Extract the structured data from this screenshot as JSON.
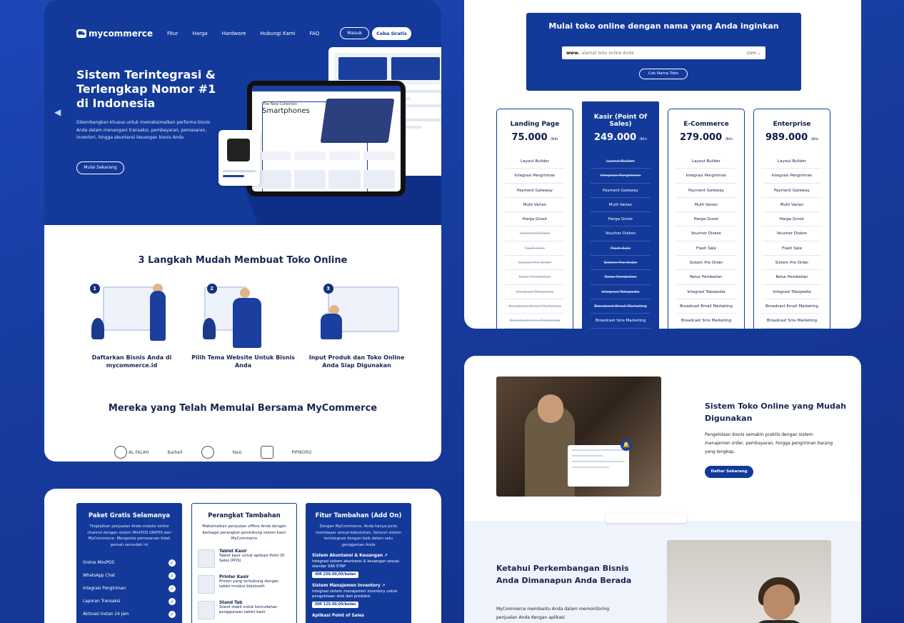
{
  "hero": {
    "logo": "mycommerce",
    "nav": [
      "Fitur",
      "Harga",
      "Hardware",
      "Hubungi Kami",
      "FAQ"
    ],
    "masuk": "Masuk",
    "coba": "Coba Gratis",
    "title": "Sistem Terintegrasi & Terlengkap Nomor #1 di Indonesia",
    "desc": "Dikembangkan khusus untuk memaksimalkan performa bisnis Anda dalam menangani transaksi, pembayaran, pemasaran, inventori, hingga akuntansi keuangan bisnis Anda",
    "cta": "Mulai Sekarang",
    "tablet_collection": "The New Collection",
    "tablet_heading": "Smartphones"
  },
  "steps": {
    "title": "3 Langkah Mudah Membuat Toko Online",
    "items": [
      {
        "num": "1",
        "label": "Daftarkan Bisnis Anda di mycommerce.id"
      },
      {
        "num": "2",
        "label": "Pilih Tema Website Untuk Bisnis Anda"
      },
      {
        "num": "3",
        "label": "Input Produk dan Toko Online Anda Siap Digunakan"
      }
    ]
  },
  "clients": {
    "title": "Mereka yang Telah Memulai Bersama MyCommerce",
    "logos": [
      "AL FALAH",
      "Barbell",
      "",
      "Nasi",
      "",
      "PIPIKORO"
    ]
  },
  "domain": {
    "title": "Mulai toko online dengan nama yang Anda inginkan",
    "prefix": "www.",
    "placeholder": "alamat toko online Anda",
    "suffix": ".com",
    "button": "Cek Nama Toko"
  },
  "plans": [
    {
      "name": "Landing Page",
      "price": "75.000",
      "per": "/bln",
      "featured": false,
      "features": [
        [
          "Layout Builder",
          true
        ],
        [
          "Integrasi Pengiriman",
          true
        ],
        [
          "Payment Gateway",
          true
        ],
        [
          "Multi Varian",
          true
        ],
        [
          "Harga Grosir",
          true
        ],
        [
          "Voucher Diskon",
          false
        ],
        [
          "Flash Sale",
          false
        ],
        [
          "Sistem Pre Order",
          false
        ],
        [
          "Retur Pembelian",
          false
        ],
        [
          "Integrasi Tokopedia",
          false
        ],
        [
          "Broadcast Email Marketing",
          false
        ],
        [
          "Broadcast Sms Marketing",
          false
        ]
      ]
    },
    {
      "name": "Kasir (Point Of Sales)",
      "price": "249.000",
      "per": "/bln",
      "featured": true,
      "features": [
        [
          "Layout Builder",
          false
        ],
        [
          "Integrasi Pengiriman",
          false
        ],
        [
          "Payment Gateway",
          true
        ],
        [
          "Multi Varian",
          true
        ],
        [
          "Harga Grosir",
          true
        ],
        [
          "Voucher Diskon",
          true
        ],
        [
          "Flash Sale",
          false
        ],
        [
          "Sistem Pre Order",
          false
        ],
        [
          "Retur Pembelian",
          false
        ],
        [
          "Integrasi Tokopedia",
          false
        ],
        [
          "Broadcast Email Marketing",
          false
        ],
        [
          "Broadcast Sms Marketing",
          true
        ]
      ]
    },
    {
      "name": "E-Commerce",
      "price": "279.000",
      "per": "/bln",
      "featured": false,
      "features": [
        [
          "Layout Builder",
          true
        ],
        [
          "Integrasi Pengiriman",
          true
        ],
        [
          "Payment Gateway",
          true
        ],
        [
          "Multi Varian",
          true
        ],
        [
          "Harga Grosir",
          true
        ],
        [
          "Voucher Diskon",
          true
        ],
        [
          "Flash Sale",
          true
        ],
        [
          "Sistem Pre Order",
          true
        ],
        [
          "Retur Pembelian",
          true
        ],
        [
          "Integrasi Tokopedia",
          true
        ],
        [
          "Broadcast Email Marketing",
          true
        ],
        [
          "Broadcast Sms Marketing",
          true
        ]
      ]
    },
    {
      "name": "Enterprise",
      "price": "989.000",
      "per": "/bln",
      "featured": false,
      "features": [
        [
          "Layout Builder",
          true
        ],
        [
          "Integrasi Pengiriman",
          true
        ],
        [
          "Payment Gateway",
          true
        ],
        [
          "Multi Varian",
          true
        ],
        [
          "Harga Grosir",
          true
        ],
        [
          "Voucher Diskon",
          true
        ],
        [
          "Flash Sale",
          true
        ],
        [
          "Sistem Pre Order",
          true
        ],
        [
          "Retur Pembelian",
          true
        ],
        [
          "Integrasi Tokopedia",
          true
        ],
        [
          "Broadcast Email Marketing",
          true
        ],
        [
          "Broadcast Sms Marketing",
          true
        ]
      ]
    }
  ],
  "paket": {
    "title": "Paket Gratis Selamanya",
    "desc": "Tingkatkan penjualan Anda melalui online channel dengan sistem MiniPOS GRATIS dari MyCommerce. Mengelola pemesanan tidak pernah semudah ini",
    "items": [
      "Online MiniPOS",
      "WhatsApp Chat",
      "Integrasi Pengiriman",
      "Laporan Transaksi",
      "Aktivasi Instan 24 Jam"
    ]
  },
  "perangkat": {
    "title": "Perangkat Tambahan",
    "desc": "Maksimalkan penjualan offline Anda dengan berbagai perangkat pendukung sistem kasir MyCommerce",
    "items": [
      {
        "name": "Tablet Kasir",
        "desc": "Tablet kasir untuk aplikasi Point Of Sales (POS)"
      },
      {
        "name": "Printer Kasir",
        "desc": "Printer yang terhubung dengan tablet melalui bluetooth"
      },
      {
        "name": "Stand Tab",
        "desc": "Stand stabil untuk kemudahan penggunaan tablet kasir"
      }
    ]
  },
  "addon": {
    "title": "Fitur Tambahan (Add On)",
    "desc": "Dengan MyCommerce, Anda hanya perlu membayar sesuai kebutuhan. Seluruh sistem terintegrasi dengan baik dalam satu genggaman Anda",
    "items": [
      {
        "name": "Sistem Akuntansi & Keuangan",
        "desc": "Integrasi sistem akuntansi & keuangan sesuai standar SAK ETAP",
        "price": "IDR 250.00,00/bulan"
      },
      {
        "name": "Sistem Manajemen Inventory",
        "desc": "Integrasi sistem manajemen inventory untuk pengelolaan stok dan produksi",
        "price": "IDR 125.00,00/bulan"
      },
      {
        "name": "Aplikasi Point of Sales",
        "desc": "",
        "price": ""
      }
    ]
  },
  "toko": {
    "title": "Sistem Toko Online yang Mudah Digunakan",
    "desc": "Pengelolaan bisnis semakin praktis dengan sistem manajemen order, pembayaran, hingga pengiriman barang yang lengkap.",
    "button": "Daftar Sekarang"
  },
  "ketahui": {
    "title": "Ketahui Perkembangan Bisnis Anda Dimanapun Anda Berada",
    "desc": "MyCommerce membantu Anda dalam memonitoring penjualan Anda dengan aplikasi"
  },
  "colors": {
    "brand": "#133a9a",
    "background": "#1d46b8",
    "white": "#ffffff"
  }
}
